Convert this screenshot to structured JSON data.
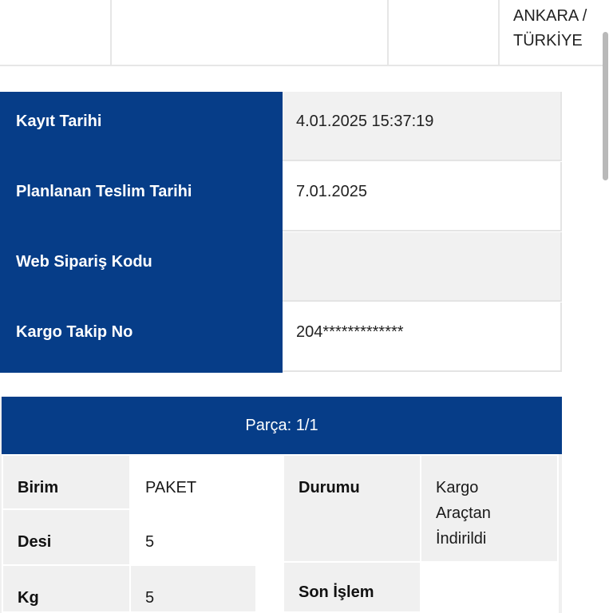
{
  "address": {
    "line": "ANKARA / TÜRKİYE"
  },
  "info_rows": [
    {
      "label": "Kayıt Tarihi",
      "value": "4.01.2025 15:37:19"
    },
    {
      "label": "Planlanan Teslim Tarihi",
      "value": "7.01.2025"
    },
    {
      "label": "Web Sipariş Kodu",
      "value": ""
    },
    {
      "label": "Kargo Takip No",
      "value": "204*************"
    }
  ],
  "parca": {
    "header": "Parça: 1/1",
    "left": [
      {
        "label": "Birim",
        "value": "PAKET"
      },
      {
        "label": "Desi",
        "value": "5"
      },
      {
        "label": "Kg",
        "value": "5"
      }
    ],
    "right": [
      {
        "label": "Durumu",
        "value": "Kargo Araçtan İndirildi"
      },
      {
        "label": "Son İşlem",
        "value": ""
      }
    ]
  }
}
